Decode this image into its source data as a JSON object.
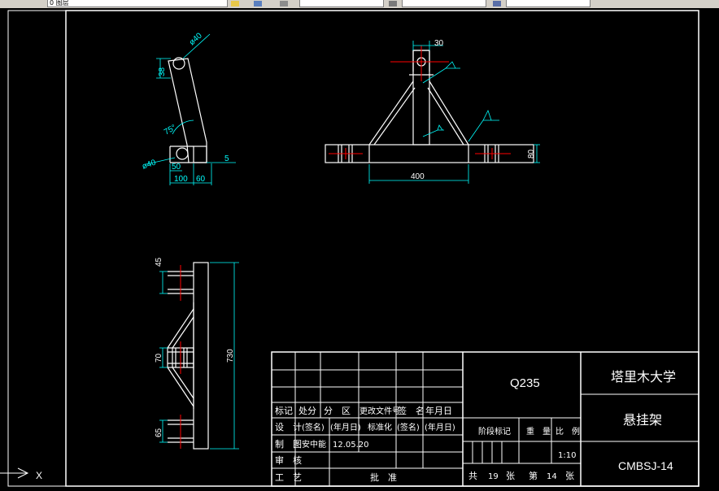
{
  "toolbar": {
    "layer_field": "0 图层",
    "linetype_field": "",
    "color_field": "",
    "lineweight_field": ""
  },
  "drawing": {
    "part_a_dims": {
      "dia_top": "ø40",
      "r38": "38",
      "angle": "75°",
      "dia_bottom": "ø40",
      "d50": "50",
      "d5": "5",
      "d100": "100",
      "d60": "60"
    },
    "part_b_dims": {
      "d30": "30",
      "d400": "400",
      "d80": "80"
    },
    "part_c_dims": {
      "d45": "45",
      "d70": "70",
      "d65": "65",
      "d730": "730"
    }
  },
  "title_block": {
    "material": "Q235",
    "school": "塔里木大学",
    "part_name": "悬挂架",
    "drawing_no": "CMBSJ-14",
    "headers": {
      "mark": "标记",
      "count": "处分",
      "zone": "分　区",
      "change_doc": "更改文件号",
      "signature": "签　名",
      "date": "年月日"
    },
    "row_design": {
      "label": "设　计",
      "sign": "(签名)",
      "date": "(年月日)",
      "std_label": "标准化",
      "std_sign": "(签名)",
      "std_date": "(年月日)"
    },
    "row_draw": {
      "label": "制　图",
      "name": "安中能",
      "date": "12.05.20"
    },
    "row_review": {
      "label": "审　核"
    },
    "row_process": {
      "label": "工　艺",
      "approve": "批　准"
    },
    "stage_label": "阶段标记",
    "weight_label": "重　量",
    "scale_label": "比　例",
    "scale": "1:10",
    "sheets_total_label": "共",
    "sheets_total": "19",
    "sheets_unit": "张",
    "sheet_no_label": "第",
    "sheet_no": "14",
    "sheet_no_unit": "张"
  },
  "ucs": {
    "x_label": "X"
  },
  "colors": {
    "background": "#000000",
    "lines": "#ffffff",
    "dimensions": "#00ffff",
    "centerlines": "#ff0000"
  }
}
